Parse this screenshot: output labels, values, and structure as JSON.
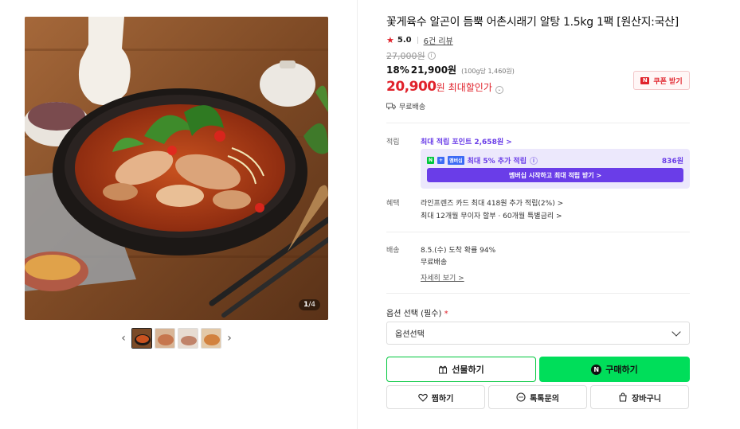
{
  "product": {
    "title": "꽃게육수 알곤이 듬뿍 어촌시래기 알탕 1.5kg 1팩 [원산지:국산]",
    "rating": "5.0",
    "review_link": "6건 리뷰",
    "original_price": "27,000원",
    "discount_pct": "18%",
    "sale_price": "21,900원",
    "unit_price": "(100g당 1,460원)",
    "best_price": "20,900",
    "best_price_unit": "원",
    "best_price_label": "최대할인가",
    "coupon_button": "쿠폰 받기",
    "shipping_free": "무료배송"
  },
  "images": {
    "counter_current": "1",
    "counter_total": "/4"
  },
  "points": {
    "label": "적립",
    "max_point_text": "최대 적립 포인트 2,658원 >",
    "member_badge_n": "N",
    "member_badge_plus": "+",
    "member_badge_text": "멤버십",
    "member_text": "최대 5% 추가 적립",
    "member_amount": "836원",
    "member_button": "멤버십 시작하고 최대 적립 받기 >"
  },
  "benefits": {
    "label": "혜택",
    "line1": "라인프렌즈 카드 최대 418원 추가 적립(2%) >",
    "line2": "최대 12개월 무이자 할부 · 60개월 특별금리 >"
  },
  "delivery": {
    "label": "배송",
    "line1": "8.5.(수) 도착 확률 94%",
    "line2": "무료배송",
    "detail_link": "자세히 보기 >"
  },
  "option": {
    "label": "옵션 선택 (필수)",
    "required_mark": "*",
    "selected": "옵션선택"
  },
  "actions": {
    "gift": "선물하기",
    "buy": "구매하기",
    "wish": "찜하기",
    "talk": "톡톡문의",
    "cart": "장바구니"
  },
  "colors": {
    "accent_red": "#e0222b",
    "naver_green": "#00de5a",
    "membership_purple": "#6a3de8"
  }
}
